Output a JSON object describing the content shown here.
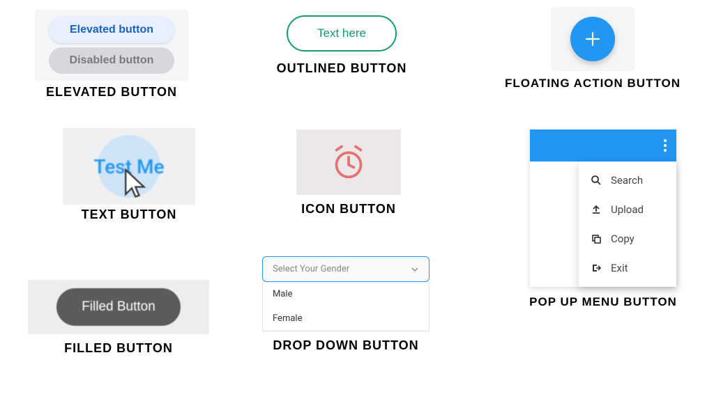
{
  "elevated": {
    "primary_label": "Elevated button",
    "disabled_label": "Disabled button",
    "caption": "ELEVATED BUTTON"
  },
  "outlined": {
    "label": "Text here",
    "caption": "OUTLINED BUTTON"
  },
  "fab": {
    "caption": "FLOATING ACTION BUTTON"
  },
  "text_button": {
    "label": "Test Me",
    "caption": "TEXT BUTTON"
  },
  "icon_button": {
    "caption": "ICON BUTTON"
  },
  "filled": {
    "label": "Filled Button",
    "caption": "FILLED BUTTON"
  },
  "dropdown": {
    "placeholder": "Select Your Gender",
    "options": [
      "Male",
      "Female"
    ],
    "caption": "DROP DOWN BUTTON"
  },
  "popup": {
    "items": [
      {
        "label": "Search"
      },
      {
        "label": "Upload"
      },
      {
        "label": "Copy"
      },
      {
        "label": "Exit"
      }
    ],
    "caption": "POP UP MENU BUTTON"
  }
}
